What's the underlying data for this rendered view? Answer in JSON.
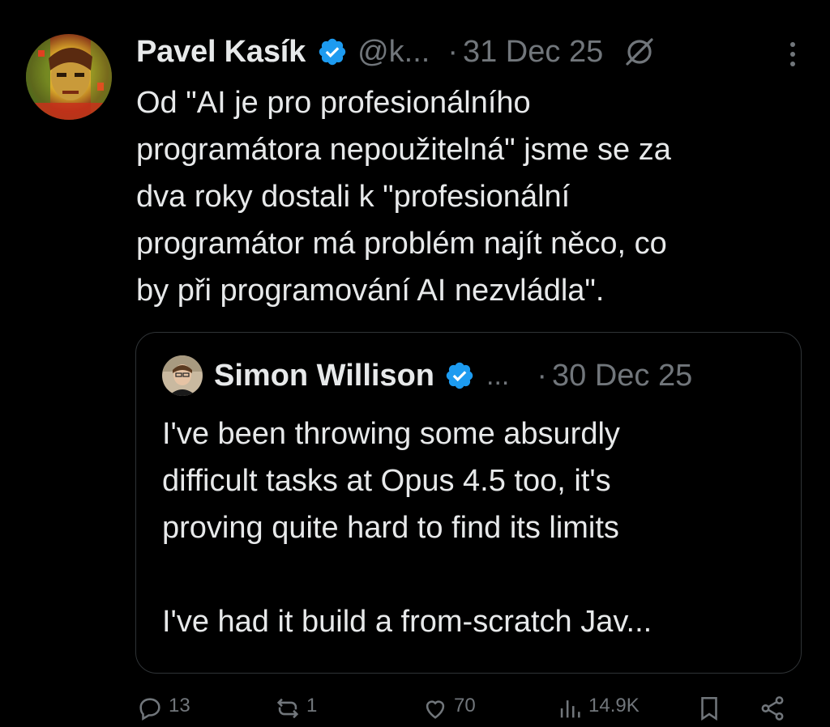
{
  "tweet": {
    "author": {
      "display_name": "Pavel Kasík",
      "handle": "@k...",
      "verified_icon": "verified-badge-icon"
    },
    "separator": "·",
    "timestamp": "31 Dec 25",
    "text_lines": [
      "Od \"AI je pro profesionálního",
      "programátora nepoužitelná\" jsme se za",
      "dva roky dostali k \"profesionální",
      "programátor má problém najít něco, co",
      "by při programování AI nezvládla\"."
    ]
  },
  "quote": {
    "author": {
      "display_name": "Simon Willison",
      "ellipsis": "...",
      "verified_icon": "verified-badge-icon"
    },
    "separator": "·",
    "timestamp": "30 Dec 25",
    "text_lines": [
      "I've been throwing some absurdly",
      "difficult tasks at Opus 4.5 too, it's",
      "proving quite hard to find its limits"
    ],
    "text_lines_after_gap": [
      "I've had it build a from-scratch Jav..."
    ]
  },
  "actions": {
    "replies": "13",
    "reposts": "1",
    "likes": "70",
    "views": "14.9K"
  },
  "colors": {
    "background": "#000000",
    "text_primary": "#e7e9ea",
    "text_secondary": "#71767b",
    "verified_blue": "#1d9bf0",
    "border": "#2f3336"
  }
}
